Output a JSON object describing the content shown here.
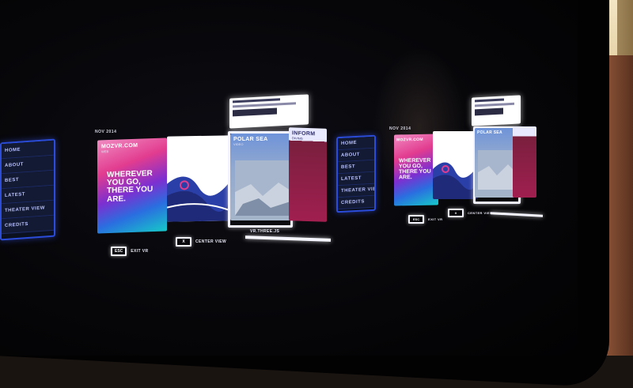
{
  "nav": {
    "menu_items": [
      "HOME",
      "ABOUT",
      "BEST",
      "LATEST",
      "THEATER VIEW",
      "CREDITS"
    ]
  },
  "gallery": {
    "month": "NOV 2014",
    "cards": [
      {
        "id": "mozvr",
        "title": "MOZVR.COM",
        "subtitle": "WEB",
        "slogan": "WHEREVER YOU GO, THERE YOU ARE."
      },
      {
        "id": "rollercoaster",
        "title": "",
        "subtitle": ""
      },
      {
        "id": "polar",
        "title": "POLAR SEA",
        "subtitle": "VIDEO"
      },
      {
        "id": "inform",
        "title": "INFORM",
        "subtitle": "DIVING"
      }
    ],
    "selected_caption": "VR.THREE.JS"
  },
  "hints": [
    {
      "key": "ESC",
      "label": "EXIT VR"
    },
    {
      "key": "X",
      "label": "CENTER VIEW"
    }
  ],
  "colors": {
    "menu_border": "#2a4cd8",
    "highlight": "#f5f5ff"
  }
}
